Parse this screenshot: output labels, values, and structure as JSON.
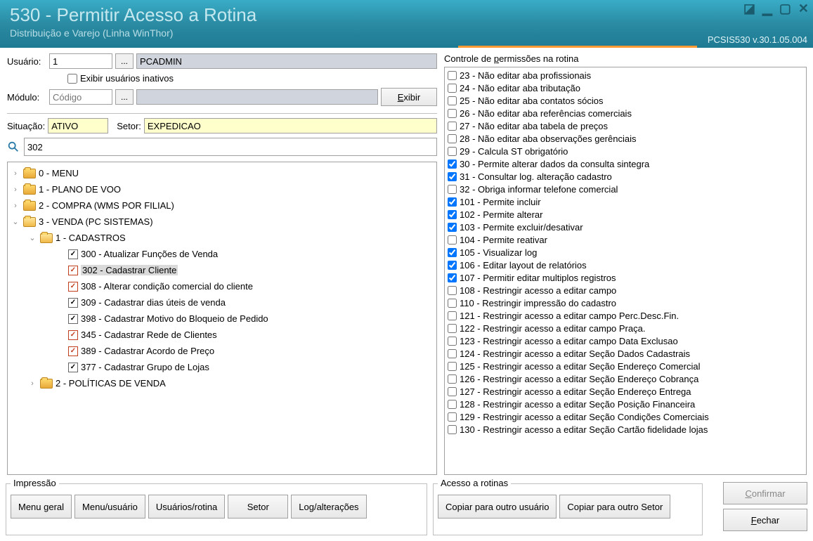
{
  "header": {
    "title": "530 - Permitir Acesso a Rotina",
    "subtitle": "Distribuição e Varejo (Linha WinThor)",
    "version": "PCSIS530   v.30.1.05.004"
  },
  "form": {
    "usuario_label": "Usuário:",
    "usuario_value": "1",
    "usuario_name": "PCADMIN",
    "exibir_inativos": "Exibir usuários inativos",
    "modulo_label": "Módulo:",
    "modulo_placeholder": "Código",
    "exibir_btn": "Exibir",
    "situacao_label": "Situação:",
    "situacao_value": "ATIVO",
    "setor_label": "Setor:",
    "setor_value": "EXPEDICAO",
    "search_value": "302"
  },
  "tree": [
    {
      "level": 1,
      "exp": ">",
      "type": "folder",
      "label": "0 - MENU"
    },
    {
      "level": 1,
      "exp": ">",
      "type": "folder",
      "label": "1 - PLANO DE VOO"
    },
    {
      "level": 1,
      "exp": ">",
      "type": "folder",
      "label": "2 - COMPRA           (WMS POR FILIAL)"
    },
    {
      "level": 1,
      "exp": "v",
      "type": "folder-open",
      "label": "3 - VENDA               (PC SISTEMAS)"
    },
    {
      "level": 2,
      "exp": "v",
      "type": "folder-open",
      "label": "1 - CADASTROS"
    },
    {
      "level": 3,
      "cb": "black",
      "label": "300 - Atualizar Funções de Venda"
    },
    {
      "level": 3,
      "cb": "red",
      "label": "302 - Cadastrar Cliente",
      "selected": true
    },
    {
      "level": 3,
      "cb": "red",
      "label": "308 - Alterar condição comercial do cliente"
    },
    {
      "level": 3,
      "cb": "black",
      "label": "309 - Cadastrar dias úteis de venda"
    },
    {
      "level": 3,
      "cb": "black",
      "label": "398 - Cadastrar Motivo do Bloqueio de Pedido"
    },
    {
      "level": 3,
      "cb": "red",
      "label": "345 - Cadastrar Rede de Clientes"
    },
    {
      "level": 3,
      "cb": "red",
      "label": "389 - Cadastrar Acordo de Preço"
    },
    {
      "level": 3,
      "cb": "black",
      "label": "377 - Cadastrar Grupo de Lojas"
    },
    {
      "level": 2,
      "exp": ">",
      "type": "folder",
      "label": "2 - POLÍTICAS DE VENDA"
    }
  ],
  "perm_title": "Controle de permissões na rotina",
  "permissions": [
    {
      "c": false,
      "t": "23 - Não editar aba profissionais"
    },
    {
      "c": false,
      "t": "24 - Não editar aba tributação"
    },
    {
      "c": false,
      "t": "25 - Não editar aba contatos sócios"
    },
    {
      "c": false,
      "t": "26 - Não editar aba referências comerciais"
    },
    {
      "c": false,
      "t": "27 - Não editar aba tabela de preços"
    },
    {
      "c": false,
      "t": "28 - Não editar aba observações gerênciais"
    },
    {
      "c": false,
      "t": "29 - Calcula ST obrigatório"
    },
    {
      "c": true,
      "t": "30 - Permite alterar dados da consulta sintegra"
    },
    {
      "c": true,
      "t": "31 - Consultar log. alteração cadastro"
    },
    {
      "c": false,
      "t": "32 - Obriga informar telefone comercial"
    },
    {
      "c": true,
      "t": "101 - Permite incluir"
    },
    {
      "c": true,
      "t": "102 - Permite alterar"
    },
    {
      "c": true,
      "t": "103 - Permite excluir/desativar"
    },
    {
      "c": false,
      "t": "104 - Permite reativar"
    },
    {
      "c": true,
      "t": "105 - Visualizar log"
    },
    {
      "c": true,
      "t": "106 - Editar layout de relatórios"
    },
    {
      "c": true,
      "t": "107 - Permitir editar multiplos registros"
    },
    {
      "c": false,
      "t": "108 - Restringir acesso a editar campo"
    },
    {
      "c": false,
      "t": "110 - Restringir impressão do cadastro"
    },
    {
      "c": false,
      "t": "121 - Restringir acesso a editar campo Perc.Desc.Fin."
    },
    {
      "c": false,
      "t": "122 - Restringir acesso a editar campo Praça."
    },
    {
      "c": false,
      "t": "123 - Restringir acesso a editar campo Data Exclusao"
    },
    {
      "c": false,
      "t": "124 - Restringir acesso a editar Seção Dados Cadastrais"
    },
    {
      "c": false,
      "t": "125 - Restringir acesso a editar Seção Endereço Comercial"
    },
    {
      "c": false,
      "t": "126 - Restringir acesso a editar Seção Endereço Cobrança"
    },
    {
      "c": false,
      "t": "127 - Restringir acesso a editar Seção Endereço Entrega"
    },
    {
      "c": false,
      "t": "128 - Restringir acesso a editar Seção Posição Financeira"
    },
    {
      "c": false,
      "t": "129 - Restringir acesso a editar Seção Condições Comerciais"
    },
    {
      "c": false,
      "t": "130 - Restringir acesso a editar Seção Cartão fidelidade lojas"
    }
  ],
  "impressao": {
    "title": "Impressão",
    "b1": "Menu geral",
    "b2": "Menu/usuário",
    "b3": "Usuários/rotina",
    "b4": "Setor",
    "b5": "Log/alterações"
  },
  "acesso": {
    "title": "Acesso a rotinas",
    "b1": "Copiar para outro usuário",
    "b2": "Copiar para outro Setor"
  },
  "actions": {
    "confirmar": "Confirmar",
    "fechar": "Fechar"
  }
}
